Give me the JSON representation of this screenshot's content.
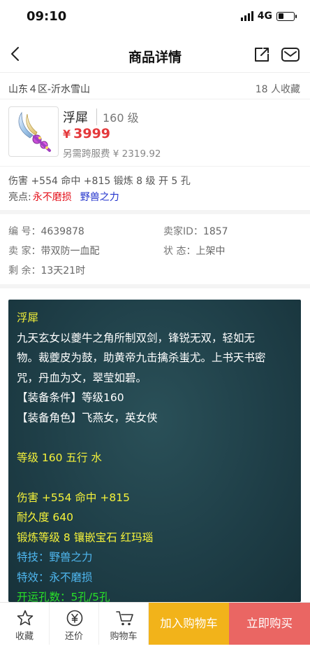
{
  "status": {
    "time": "09:10",
    "network": "4G",
    "battery_level": 0.35
  },
  "nav": {
    "title": "商品详情"
  },
  "server": {
    "name": "山东４区-沂水雪山",
    "favorites": "18 人收藏"
  },
  "item": {
    "name": "浮犀",
    "level": "160 级",
    "currency": "¥",
    "price": "3999",
    "cross_server_fee": "另需跨服费 ¥ 2319.92"
  },
  "attributes": {
    "stats": "伤害 +554 命中 +815 锻炼 8 级 开 5 孔",
    "highlights_label": "亮点:",
    "highlights": [
      "永不磨损",
      "野兽之力"
    ]
  },
  "meta": {
    "id_label": "编 号：",
    "id_value": "4639878",
    "seller_id_label": "卖家ID：",
    "seller_id_value": "1857",
    "seller_label": "卖 家：",
    "seller_value": "带双防一血配",
    "state_label": "状 态：",
    "state_value": "上架中",
    "remaining_label": "剩 余：",
    "remaining_value": "13天21时"
  },
  "description": {
    "lines": [
      {
        "text": "浮犀",
        "color": "yellow"
      },
      {
        "text": "九天玄女以夔牛之角所制双剑，锋锐无双，轻如无",
        "color": "white"
      },
      {
        "text": "物。裁夔皮为鼓，助黄帝九击擒杀蚩尤。上书天书密",
        "color": "white"
      },
      {
        "text": "咒，丹血为文，翠莹如碧。",
        "color": "white"
      },
      {
        "text": "【装备条件】等级160",
        "color": "white"
      },
      {
        "text": "【装备角色】飞燕女，英女侠",
        "color": "white"
      },
      {
        "text": "",
        "color": "white"
      },
      {
        "text": "等级 160 五行 水",
        "color": "yellow"
      },
      {
        "text": "",
        "color": "white"
      },
      {
        "text": "伤害 +554 命中 +815",
        "color": "yellow"
      },
      {
        "text": "耐久度 640",
        "color": "yellow"
      },
      {
        "text": "锻炼等级 8 镶嵌宝石 红玛瑙",
        "color": "yellow"
      },
      {
        "text": "特技：野兽之力",
        "color": "blue"
      },
      {
        "text": "特效：永不磨损",
        "color": "blue"
      },
      {
        "text": "开运孔数：5孔/5孔",
        "color": "green"
      }
    ]
  },
  "bottom": {
    "favorite": "收藏",
    "bargain": "还价",
    "cart": "购物车",
    "add_to_cart": "加入购物车",
    "buy_now": "立即购买"
  },
  "colors": {
    "price_red": "#e4393c",
    "cart_button": "#f2b31a",
    "buy_button": "#ea6663",
    "desc_background": "#1f3f48"
  }
}
